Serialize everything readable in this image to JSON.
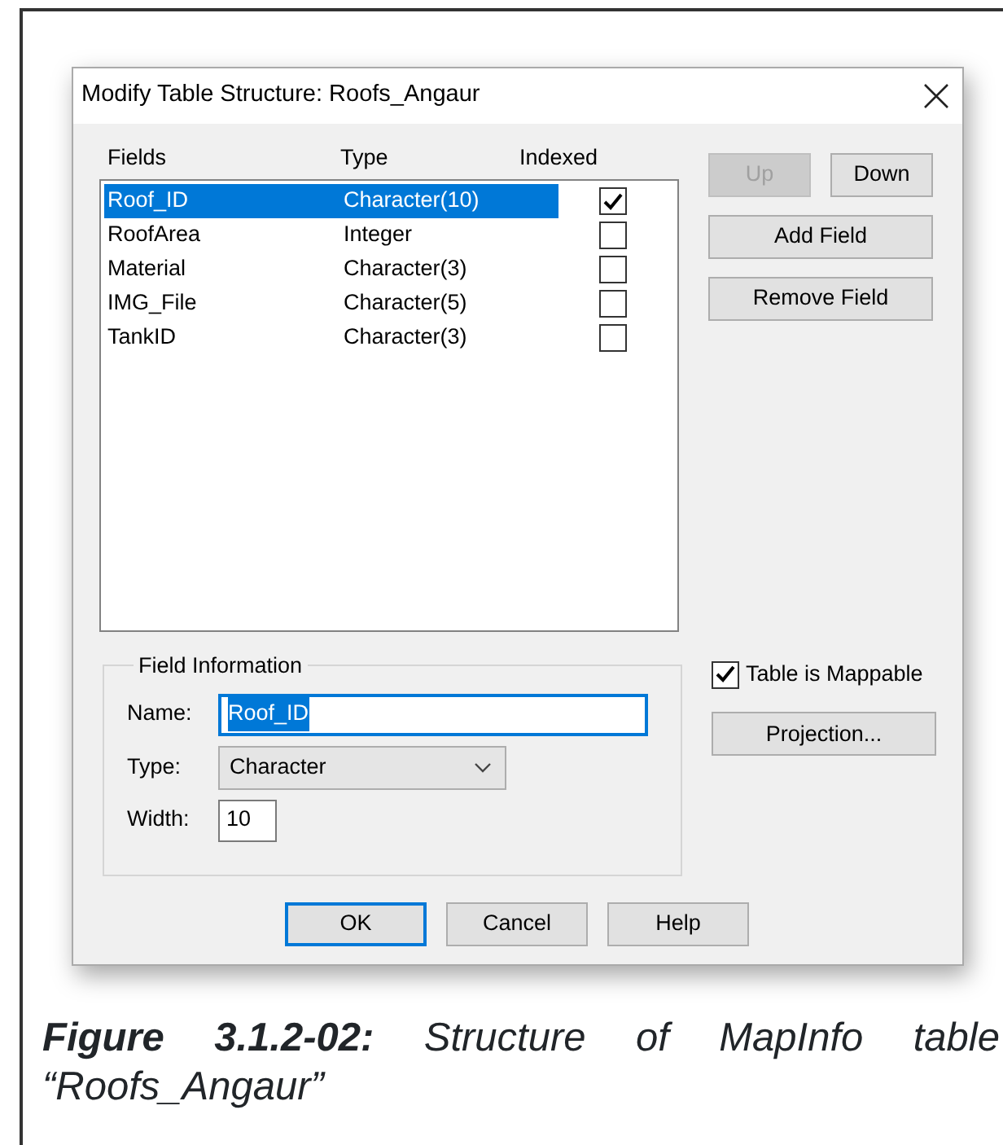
{
  "dialog": {
    "title": "Modify Table Structure: Roofs_Angaur",
    "columns": [
      "Fields",
      "Type",
      "Indexed"
    ],
    "rows": [
      {
        "field": "Roof_ID",
        "type": "Character(10)",
        "indexed": true,
        "selected": true
      },
      {
        "field": "RoofArea",
        "type": "Integer",
        "indexed": false,
        "selected": false
      },
      {
        "field": "Material",
        "type": "Character(3)",
        "indexed": false,
        "selected": false
      },
      {
        "field": "IMG_File",
        "type": "Character(5)",
        "indexed": false,
        "selected": false
      },
      {
        "field": "TankID",
        "type": "Character(3)",
        "indexed": false,
        "selected": false
      }
    ],
    "side_buttons": [
      {
        "label": "Up",
        "disabled": true
      },
      {
        "label": "Down",
        "disabled": false
      },
      {
        "label": "Add Field",
        "disabled": false
      },
      {
        "label": "Remove Field",
        "disabled": false
      }
    ],
    "field_information": {
      "title": "Field Information",
      "name_label": "Name:",
      "name_value": "Roof_ID",
      "type_label": "Type:",
      "type_value": "Character",
      "width_label": "Width:",
      "width_value": "10"
    },
    "mappable": {
      "label": "Table is Mappable",
      "checked": true
    },
    "projection_button": "Projection...",
    "footer_buttons": [
      {
        "label": "OK",
        "default": true
      },
      {
        "label": "Cancel",
        "default": false
      },
      {
        "label": "Help",
        "default": false
      }
    ]
  },
  "caption": "**Figure 3.1.2-02:** Structure of MapInfo table “Roofs_Angaur”"
}
